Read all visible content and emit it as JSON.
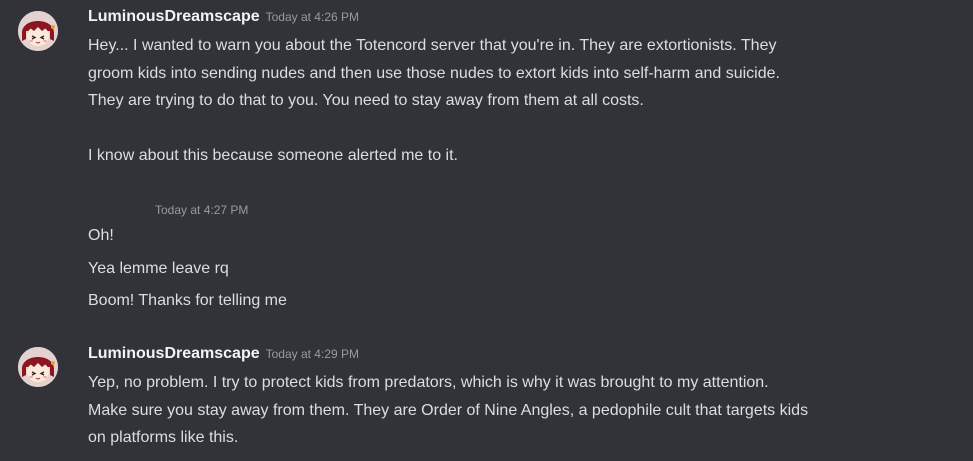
{
  "colors": {
    "background": "#313338",
    "username": "#f2f3f5",
    "text": "#dbdee1",
    "timestamp": "#949ba4"
  },
  "messages": [
    {
      "author": "LuminousDreamscape",
      "timestamp": "Today at 4:26 PM",
      "avatar_icon": "anime-girl-avatar-icon",
      "text": "Hey... I wanted to warn you about the Totencord server that you're in.  They are extortionists.  They\ngroom kids into sending nudes and then use those nudes to extort kids into self-harm and suicide.\nThey are trying to do that to you.  You need to stay away from them at all costs.\n\nI know about this because someone alerted me to it."
    },
    {
      "timestamp": "Today at 4:27 PM",
      "lines": [
        "Oh!",
        "Yea lemme leave rq",
        "Boom! Thanks for telling me"
      ]
    },
    {
      "author": "LuminousDreamscape",
      "timestamp": "Today at 4:29 PM",
      "avatar_icon": "anime-girl-avatar-icon",
      "text": "Yep, no problem.  I try to protect kids from predators, which is why it was brought to my attention.\nMake sure you stay away from them.  They are Order of Nine Angles, a pedophile cult that targets kids\non platforms like this."
    }
  ]
}
